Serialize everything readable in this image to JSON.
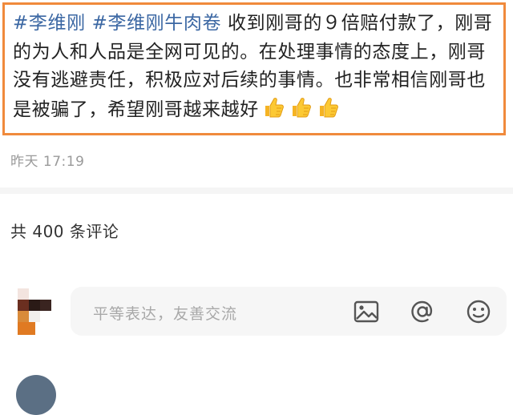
{
  "post": {
    "hashtag1": "#李维刚",
    "hashtag2": "#李维刚牛肉卷",
    "body": " 收到刚哥的９倍赔付款了，刚哥的为人和人品是全网可见的。在处理事情的态度上，刚哥没有逃避责任，积极应对后续的事情。也非常相信刚哥也是被骗了，希望刚哥越来越好",
    "emoji": [
      "thumbs-up-icon",
      "thumbs-up-icon",
      "thumbs-up-icon"
    ],
    "highlight_color": "#f08a3c",
    "hashtag_color": "#3b67a3"
  },
  "meta": {
    "timestamp": "昨天 17:19"
  },
  "comments": {
    "count_label": "共 400 条评论"
  },
  "comment_input": {
    "placeholder": "平等表达，友善交流",
    "icons": [
      "image-icon",
      "at-icon",
      "emoji-icon"
    ]
  }
}
